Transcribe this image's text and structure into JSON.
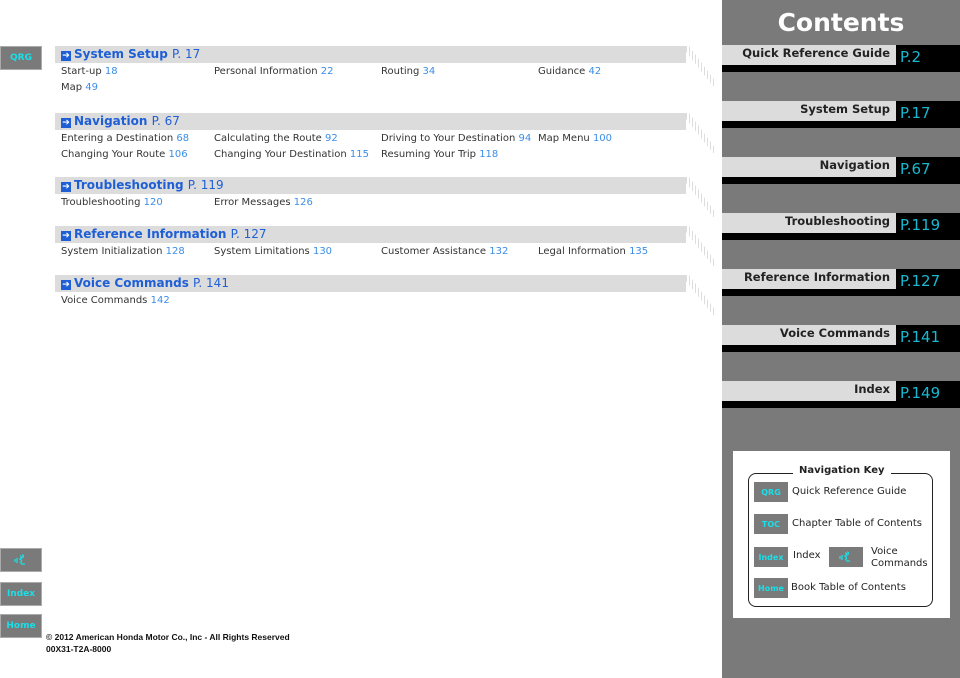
{
  "nav_buttons": {
    "qrg": "QRG",
    "voice_icon": "voice-command-icon",
    "index": "Index",
    "home": "Home"
  },
  "sections": [
    {
      "title": "System Setup",
      "page": "P. 17",
      "items": [
        {
          "label": "Start-up",
          "page": "18"
        },
        {
          "label": "Personal Information",
          "page": "22"
        },
        {
          "label": "Routing",
          "page": "34"
        },
        {
          "label": "Guidance",
          "page": "42"
        },
        {
          "label": "Map",
          "page": "49"
        }
      ]
    },
    {
      "title": "Navigation",
      "page": "P. 67",
      "items": [
        {
          "label": "Entering a Destination",
          "page": "68"
        },
        {
          "label": "Calculating the Route",
          "page": "92"
        },
        {
          "label": "Driving to Your Destination",
          "page": "94"
        },
        {
          "label": "Map Menu",
          "page": "100"
        },
        {
          "label": "Changing Your Route",
          "page": "106"
        },
        {
          "label": "Changing Your Destination",
          "page": "115"
        },
        {
          "label": "Resuming Your Trip",
          "page": "118"
        }
      ]
    },
    {
      "title": "Troubleshooting",
      "page": "P. 119",
      "items": [
        {
          "label": "Troubleshooting",
          "page": "120"
        },
        {
          "label": "Error Messages",
          "page": "126"
        }
      ]
    },
    {
      "title": "Reference Information",
      "page": "P. 127",
      "items": [
        {
          "label": "System Initialization",
          "page": "128"
        },
        {
          "label": "System Limitations",
          "page": "130"
        },
        {
          "label": "Customer Assistance",
          "page": "132"
        },
        {
          "label": "Legal Information",
          "page": "135"
        }
      ]
    },
    {
      "title": "Voice Commands",
      "page": "P. 141",
      "items": [
        {
          "label": "Voice Commands",
          "page": "142"
        }
      ]
    }
  ],
  "sidebar": {
    "title": "Contents",
    "rows": [
      {
        "label": "Quick Reference Guide",
        "page": "P.2"
      },
      {
        "label": "System Setup",
        "page": "P.17"
      },
      {
        "label": "Navigation",
        "page": "P.67"
      },
      {
        "label": "Troubleshooting",
        "page": "P.119"
      },
      {
        "label": "Reference Information",
        "page": "P.127"
      },
      {
        "label": "Voice Commands",
        "page": "P.141"
      },
      {
        "label": "Index",
        "page": "P.149"
      }
    ]
  },
  "nav_key": {
    "title": "Navigation Key",
    "qrg": "QRG",
    "qrg_label": "Quick Reference Guide",
    "toc": "TOC",
    "toc_label": "Chapter Table of Contents",
    "index": "Index",
    "index_label": "Index",
    "voice_label_1": "Voice",
    "voice_label_2": "Commands",
    "home": "Home",
    "home_label": "Book Table of Contents"
  },
  "footer": {
    "copyright": "© 2012 American Honda Motor Co., Inc - All Rights Reserved",
    "code": "00X31-T2A-8000"
  },
  "colors": {
    "link": "#3a8de8",
    "header": "#1f5fd6",
    "sidebar": "#7a7a7a",
    "button_text": "#19e0e8"
  }
}
